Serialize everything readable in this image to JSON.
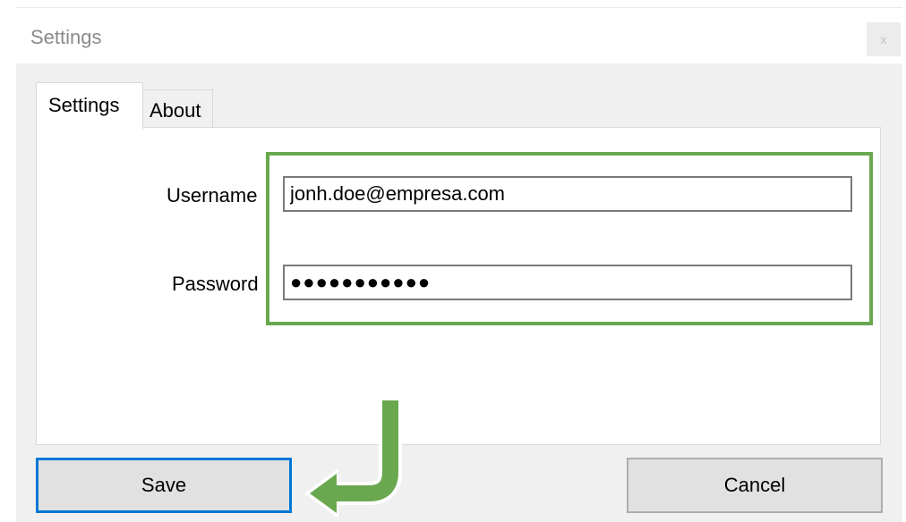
{
  "window": {
    "title": "Settings",
    "close_label": "x"
  },
  "tabs": [
    {
      "label": "Settings",
      "active": true
    },
    {
      "label": "About",
      "active": false
    }
  ],
  "form": {
    "username_label": "Username",
    "username_value": "jonh.doe@empresa.com",
    "password_label": "Password",
    "password_value": "●●●●●●●●●●●"
  },
  "buttons": {
    "save_label": "Save",
    "cancel_label": "Cancel"
  },
  "colors": {
    "highlight": "#6aa84f",
    "focus": "#0078d7"
  }
}
